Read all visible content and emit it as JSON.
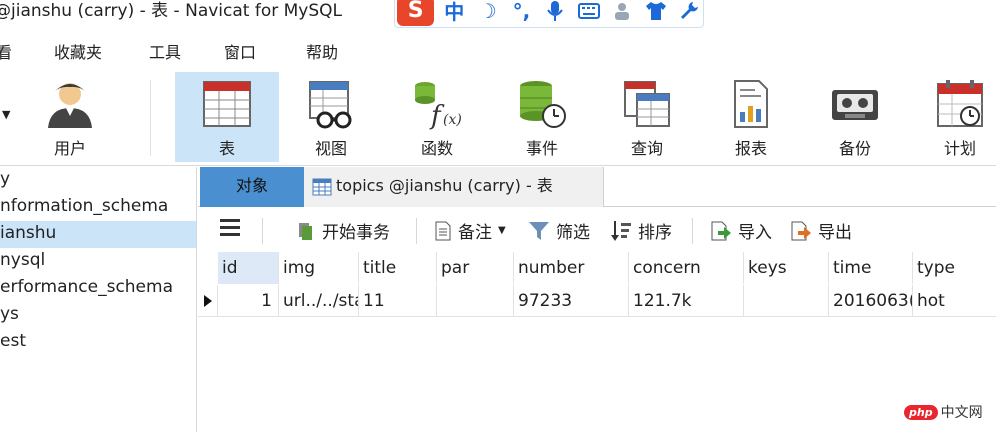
{
  "window": {
    "title": "@jianshu (carry) - 表 - Navicat for MySQL"
  },
  "ime_bar": {
    "logo": "S",
    "items": [
      "中",
      "☽",
      "°,",
      "🎤",
      "⌨",
      "👤",
      "👕",
      "🔧"
    ]
  },
  "menu": {
    "items": [
      "看",
      "收藏夹",
      "工具",
      "窗口",
      "帮助"
    ]
  },
  "toolbar": {
    "items": [
      {
        "label": "用户",
        "icon": "user-icon"
      },
      {
        "label": "表",
        "icon": "table-icon",
        "active": true
      },
      {
        "label": "视图",
        "icon": "view-icon"
      },
      {
        "label": "函数",
        "icon": "function-icon"
      },
      {
        "label": "事件",
        "icon": "event-icon"
      },
      {
        "label": "查询",
        "icon": "query-icon"
      },
      {
        "label": "报表",
        "icon": "report-icon"
      },
      {
        "label": "备份",
        "icon": "backup-icon"
      },
      {
        "label": "计划",
        "icon": "schedule-icon"
      }
    ]
  },
  "tree": {
    "items": [
      {
        "label": "y",
        "selected": false
      },
      {
        "label": "nformation_schema",
        "selected": false
      },
      {
        "label": "ianshu",
        "selected": true
      },
      {
        "label": "nysql",
        "selected": false
      },
      {
        "label": "erformance_schema",
        "selected": false
      },
      {
        "label": "ys",
        "selected": false
      },
      {
        "label": "est",
        "selected": false
      }
    ]
  },
  "tabs": {
    "objects": "对象",
    "table": "topics @jianshu (carry) - 表"
  },
  "object_toolbar": {
    "begin_transaction": "开始事务",
    "memo": "备注",
    "filter": "筛选",
    "sort": "排序",
    "import": "导入",
    "export": "导出"
  },
  "grid": {
    "columns": [
      "id",
      "img",
      "title",
      "par",
      "number",
      "concern",
      "keys",
      "time",
      "type"
    ],
    "rows": [
      [
        "1",
        "url../../sta",
        "11",
        "",
        "97233",
        "121.7k",
        "",
        "2016063(",
        "hot"
      ]
    ]
  },
  "watermark": {
    "logo": "php",
    "text": "中文网"
  },
  "colors": {
    "accent": "#4a90d0",
    "selection": "#cce4f7",
    "watermark": "#e8262d"
  }
}
